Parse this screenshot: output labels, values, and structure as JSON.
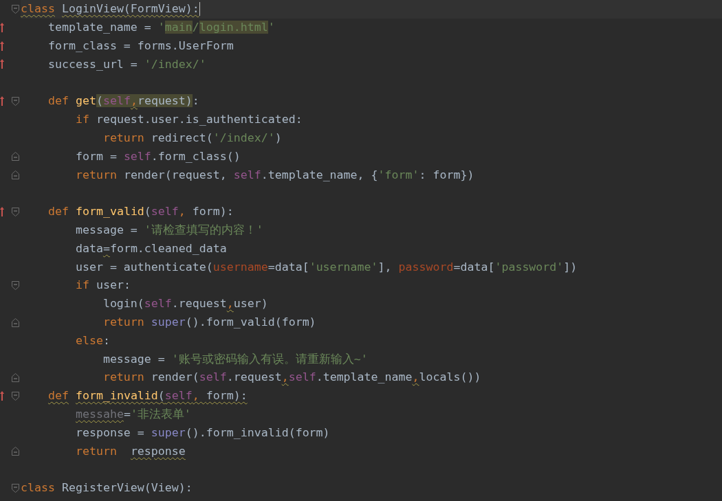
{
  "groups": [
    {
      "lines": [
        {
          "current": true,
          "fold_start": true,
          "tokens": [
            {
              "kind": "kw",
              "text": "class",
              "warn": true
            },
            {
              "kind": "plain",
              "text": " LoginView(FormView):",
              "warn": true
            }
          ]
        },
        {
          "override": true,
          "tokens": [
            {
              "kind": "plain",
              "text": "    template_name = "
            },
            {
              "kind": "str",
              "text": "'"
            },
            {
              "kind": "str",
              "text": "main",
              "hl": true
            },
            {
              "kind": "str",
              "text": "/"
            },
            {
              "kind": "str",
              "text": "login.html",
              "hl": true
            },
            {
              "kind": "str",
              "text": "'"
            }
          ]
        },
        {
          "override": true,
          "tokens": [
            {
              "kind": "plain",
              "text": "    form_class = forms.UserForm"
            }
          ]
        },
        {
          "override": true,
          "tokens": [
            {
              "kind": "plain",
              "text": "    success_url = "
            },
            {
              "kind": "str",
              "text": "'/index/'"
            }
          ]
        }
      ]
    },
    {
      "lines": [
        {
          "override": true,
          "fold_start": true,
          "tokens": [
            {
              "kind": "kw",
              "text": "    def"
            },
            {
              "kind": "fn",
              "text": " get"
            },
            {
              "kind": "plain",
              "text": "(",
              "hl": true
            },
            {
              "kind": "self",
              "text": "self",
              "hl": true
            },
            {
              "kind": "kw",
              "text": ",",
              "hl": true,
              "warn": true
            },
            {
              "kind": "plain",
              "text": "request)",
              "hl": true
            },
            {
              "kind": "plain",
              "text": ":"
            }
          ]
        },
        {
          "tokens": [
            {
              "kind": "kw",
              "text": "        if"
            },
            {
              "kind": "plain",
              "text": " request.user.is_authenticated:"
            }
          ]
        },
        {
          "tokens": [
            {
              "kind": "kw",
              "text": "            return"
            },
            {
              "kind": "plain",
              "text": " redirect("
            },
            {
              "kind": "str",
              "text": "'/index/'"
            },
            {
              "kind": "plain",
              "text": ")"
            }
          ]
        },
        {
          "fold_end": true,
          "tokens": [
            {
              "kind": "plain",
              "text": "        form = "
            },
            {
              "kind": "self",
              "text": "self"
            },
            {
              "kind": "plain",
              "text": ".form_class()"
            }
          ]
        },
        {
          "fold_end": true,
          "tokens": [
            {
              "kind": "kw",
              "text": "        return"
            },
            {
              "kind": "plain",
              "text": " render(request, "
            },
            {
              "kind": "self",
              "text": "self"
            },
            {
              "kind": "plain",
              "text": ".template_name, {"
            },
            {
              "kind": "str",
              "text": "'form'"
            },
            {
              "kind": "plain",
              "text": ": form})"
            }
          ]
        }
      ]
    },
    {
      "lines": [
        {
          "override": true,
          "fold_start": true,
          "tokens": [
            {
              "kind": "kw",
              "text": "    def"
            },
            {
              "kind": "fn",
              "text": " form_valid"
            },
            {
              "kind": "plain",
              "text": "("
            },
            {
              "kind": "self",
              "text": "self"
            },
            {
              "kind": "kw",
              "text": ","
            },
            {
              "kind": "plain",
              "text": " form):"
            }
          ]
        },
        {
          "tokens": [
            {
              "kind": "plain",
              "text": "        message = "
            },
            {
              "kind": "str",
              "text": "'请检查填写的内容！'"
            }
          ]
        },
        {
          "tokens": [
            {
              "kind": "plain",
              "text": "        data"
            },
            {
              "kind": "plain",
              "text": "=",
              "warn": true
            },
            {
              "kind": "plain",
              "text": "form.cleaned_data"
            }
          ]
        },
        {
          "tokens": [
            {
              "kind": "plain",
              "text": "        user = authenticate("
            },
            {
              "kind": "arg",
              "text": "username"
            },
            {
              "kind": "plain",
              "text": "=data["
            },
            {
              "kind": "str",
              "text": "'username'"
            },
            {
              "kind": "plain",
              "text": "], "
            },
            {
              "kind": "arg",
              "text": "password"
            },
            {
              "kind": "plain",
              "text": "=data["
            },
            {
              "kind": "str",
              "text": "'password'"
            },
            {
              "kind": "plain",
              "text": "])"
            }
          ]
        },
        {
          "fold_start": true,
          "tokens": [
            {
              "kind": "kw",
              "text": "        if"
            },
            {
              "kind": "plain",
              "text": " user:"
            }
          ]
        },
        {
          "tokens": [
            {
              "kind": "plain",
              "text": "            login("
            },
            {
              "kind": "self",
              "text": "self"
            },
            {
              "kind": "plain",
              "text": ".request"
            },
            {
              "kind": "kw",
              "text": ",",
              "warn": true
            },
            {
              "kind": "plain",
              "text": "user)"
            }
          ]
        },
        {
          "fold_end": true,
          "tokens": [
            {
              "kind": "kw",
              "text": "            return"
            },
            {
              "kind": "builtin",
              "text": " super"
            },
            {
              "kind": "plain",
              "text": "().form_valid(form)"
            }
          ]
        },
        {
          "tokens": [
            {
              "kind": "kw",
              "text": "        else"
            },
            {
              "kind": "plain",
              "text": ":"
            }
          ]
        },
        {
          "tokens": [
            {
              "kind": "plain",
              "text": "            message = "
            },
            {
              "kind": "str",
              "text": "'账号或密码输入有误。请重新输入~'"
            }
          ]
        },
        {
          "fold_end": true,
          "tokens": [
            {
              "kind": "kw",
              "text": "            return"
            },
            {
              "kind": "plain",
              "text": " render("
            },
            {
              "kind": "self",
              "text": "self"
            },
            {
              "kind": "plain",
              "text": ".request"
            },
            {
              "kind": "kw",
              "text": ",",
              "warn": true
            },
            {
              "kind": "self",
              "text": "self"
            },
            {
              "kind": "plain",
              "text": ".template_name"
            },
            {
              "kind": "kw",
              "text": ",",
              "warn": true
            },
            {
              "kind": "plain",
              "text": "locals())"
            }
          ]
        },
        {
          "override": true,
          "fold_start": true,
          "tokens": [
            {
              "kind": "kw",
              "text": "    def",
              "warn": true
            },
            {
              "kind": "fn",
              "text": " form_invalid",
              "warn": true
            },
            {
              "kind": "plain",
              "text": "(",
              "warn": true
            },
            {
              "kind": "self",
              "text": "self",
              "warn": true
            },
            {
              "kind": "kw",
              "text": ", ",
              "warn": true
            },
            {
              "kind": "plain",
              "text": "form):",
              "warn": true
            }
          ]
        },
        {
          "tokens": [
            {
              "kind": "unused",
              "text": "        messahe",
              "warn": true
            },
            {
              "kind": "plain",
              "text": "="
            },
            {
              "kind": "str",
              "text": "'非法表单'"
            }
          ]
        },
        {
          "tokens": [
            {
              "kind": "plain",
              "text": "        response = "
            },
            {
              "kind": "builtin",
              "text": "super"
            },
            {
              "kind": "plain",
              "text": "().form_invalid(form)"
            }
          ]
        },
        {
          "fold_end": true,
          "tokens": [
            {
              "kind": "kw",
              "text": "        return"
            },
            {
              "kind": "plain",
              "text": "  response",
              "warn": true
            }
          ]
        }
      ]
    },
    {
      "lines": [
        {
          "fold_start": true,
          "tokens": [
            {
              "kind": "kw",
              "text": "class"
            },
            {
              "kind": "plain",
              "text": " RegisterView(View):"
            }
          ]
        }
      ]
    }
  ]
}
